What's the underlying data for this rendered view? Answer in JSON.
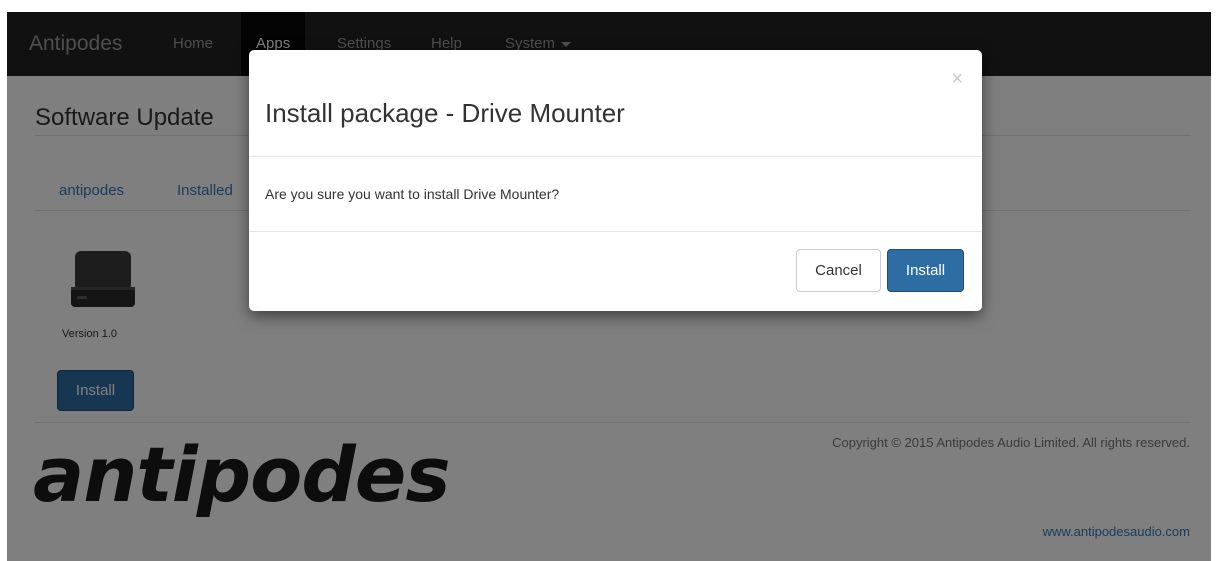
{
  "navbar": {
    "brand": "Antipodes",
    "items": [
      {
        "label": "Home",
        "active": false
      },
      {
        "label": "Apps",
        "active": true
      },
      {
        "label": "Settings",
        "active": false
      },
      {
        "label": "Help",
        "active": false
      },
      {
        "label": "System",
        "active": false,
        "dropdown": true
      }
    ]
  },
  "page": {
    "title": "Software Update",
    "tabs": [
      "antipodes",
      "Installed"
    ]
  },
  "app_card": {
    "icon": "hard-drive-icon",
    "version": "Version 1.0",
    "install_label": "Install"
  },
  "footer": {
    "logo_text": "antipodes",
    "copyright": "Copyright © 2015 Antipodes Audio Limited. All rights reserved.",
    "website": "www.antipodesaudio.com"
  },
  "modal": {
    "title": "Install package - Drive Mounter",
    "close_icon": "close-icon",
    "body": "Are you sure you want to install Drive Mounter?",
    "cancel_label": "Cancel",
    "install_label": "Install"
  },
  "colors": {
    "navbar_bg": "#222222",
    "primary": "#2e6da4",
    "link": "#337ab7"
  }
}
